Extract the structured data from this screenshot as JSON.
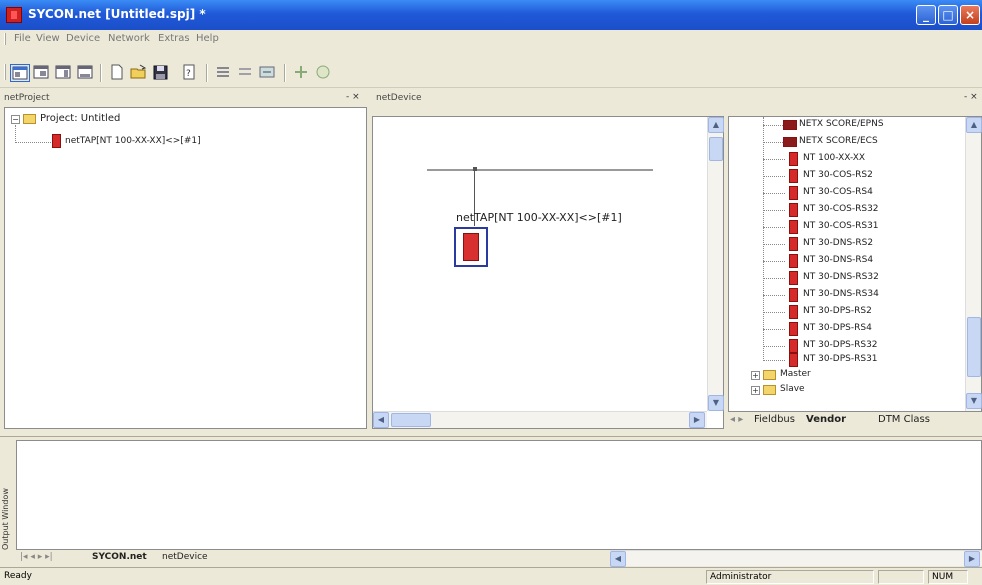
{
  "window": {
    "title": "SYCON.net  [Untitled.spj] *",
    "buttons": {
      "minimize": "_",
      "maximize": "□",
      "close": "×"
    }
  },
  "menu": {
    "items": [
      "File",
      "View",
      "Device",
      "Network",
      "Extras",
      "Help"
    ]
  },
  "toolbar": {
    "buttons": [
      "view-project-icon",
      "view-device-icon",
      "view-catalog-icon",
      "view-output-icon",
      "new-icon",
      "open-icon",
      "save-icon",
      "print-icon",
      "align-icon",
      "grid-icon",
      "network-icon",
      "help-icon",
      "about-icon"
    ]
  },
  "project_pane": {
    "title": "netProject",
    "controls": "- ×",
    "tree": {
      "root": "Project: Untitled",
      "child": "netTAP[NT 100-XX-XX]<>[#1]"
    }
  },
  "device_pane": {
    "title": "netDevice",
    "device_label": "netTAP[NT 100-XX-XX]<>[#1]"
  },
  "catalog": {
    "items": [
      "NETX SCORE/EPNS",
      "NETX SCORE/ECS",
      "NT 100-XX-XX",
      "NT 30-COS-RS2",
      "NT 30-COS-RS4",
      "NT 30-COS-RS32",
      "NT 30-COS-RS31",
      "NT 30-DNS-RS2",
      "NT 30-DNS-RS4",
      "NT 30-DNS-RS32",
      "NT 30-DNS-RS34",
      "NT 30-DPS-RS2",
      "NT 30-DPS-RS4",
      "NT 30-DPS-RS32",
      "NT 30-DPS-RS31"
    ],
    "folders": [
      "Master",
      "Slave"
    ],
    "tabs": [
      "Fieldbus",
      "Vendor",
      "DTM Class"
    ],
    "active_tab": "Vendor"
  },
  "output": {
    "side_label": "Output Window",
    "tabs": [
      "SYCON.net",
      "netDevice"
    ],
    "active_tab": "SYCON.net"
  },
  "status": {
    "left": "Ready",
    "user": "Administrator",
    "mode": "NUM"
  }
}
